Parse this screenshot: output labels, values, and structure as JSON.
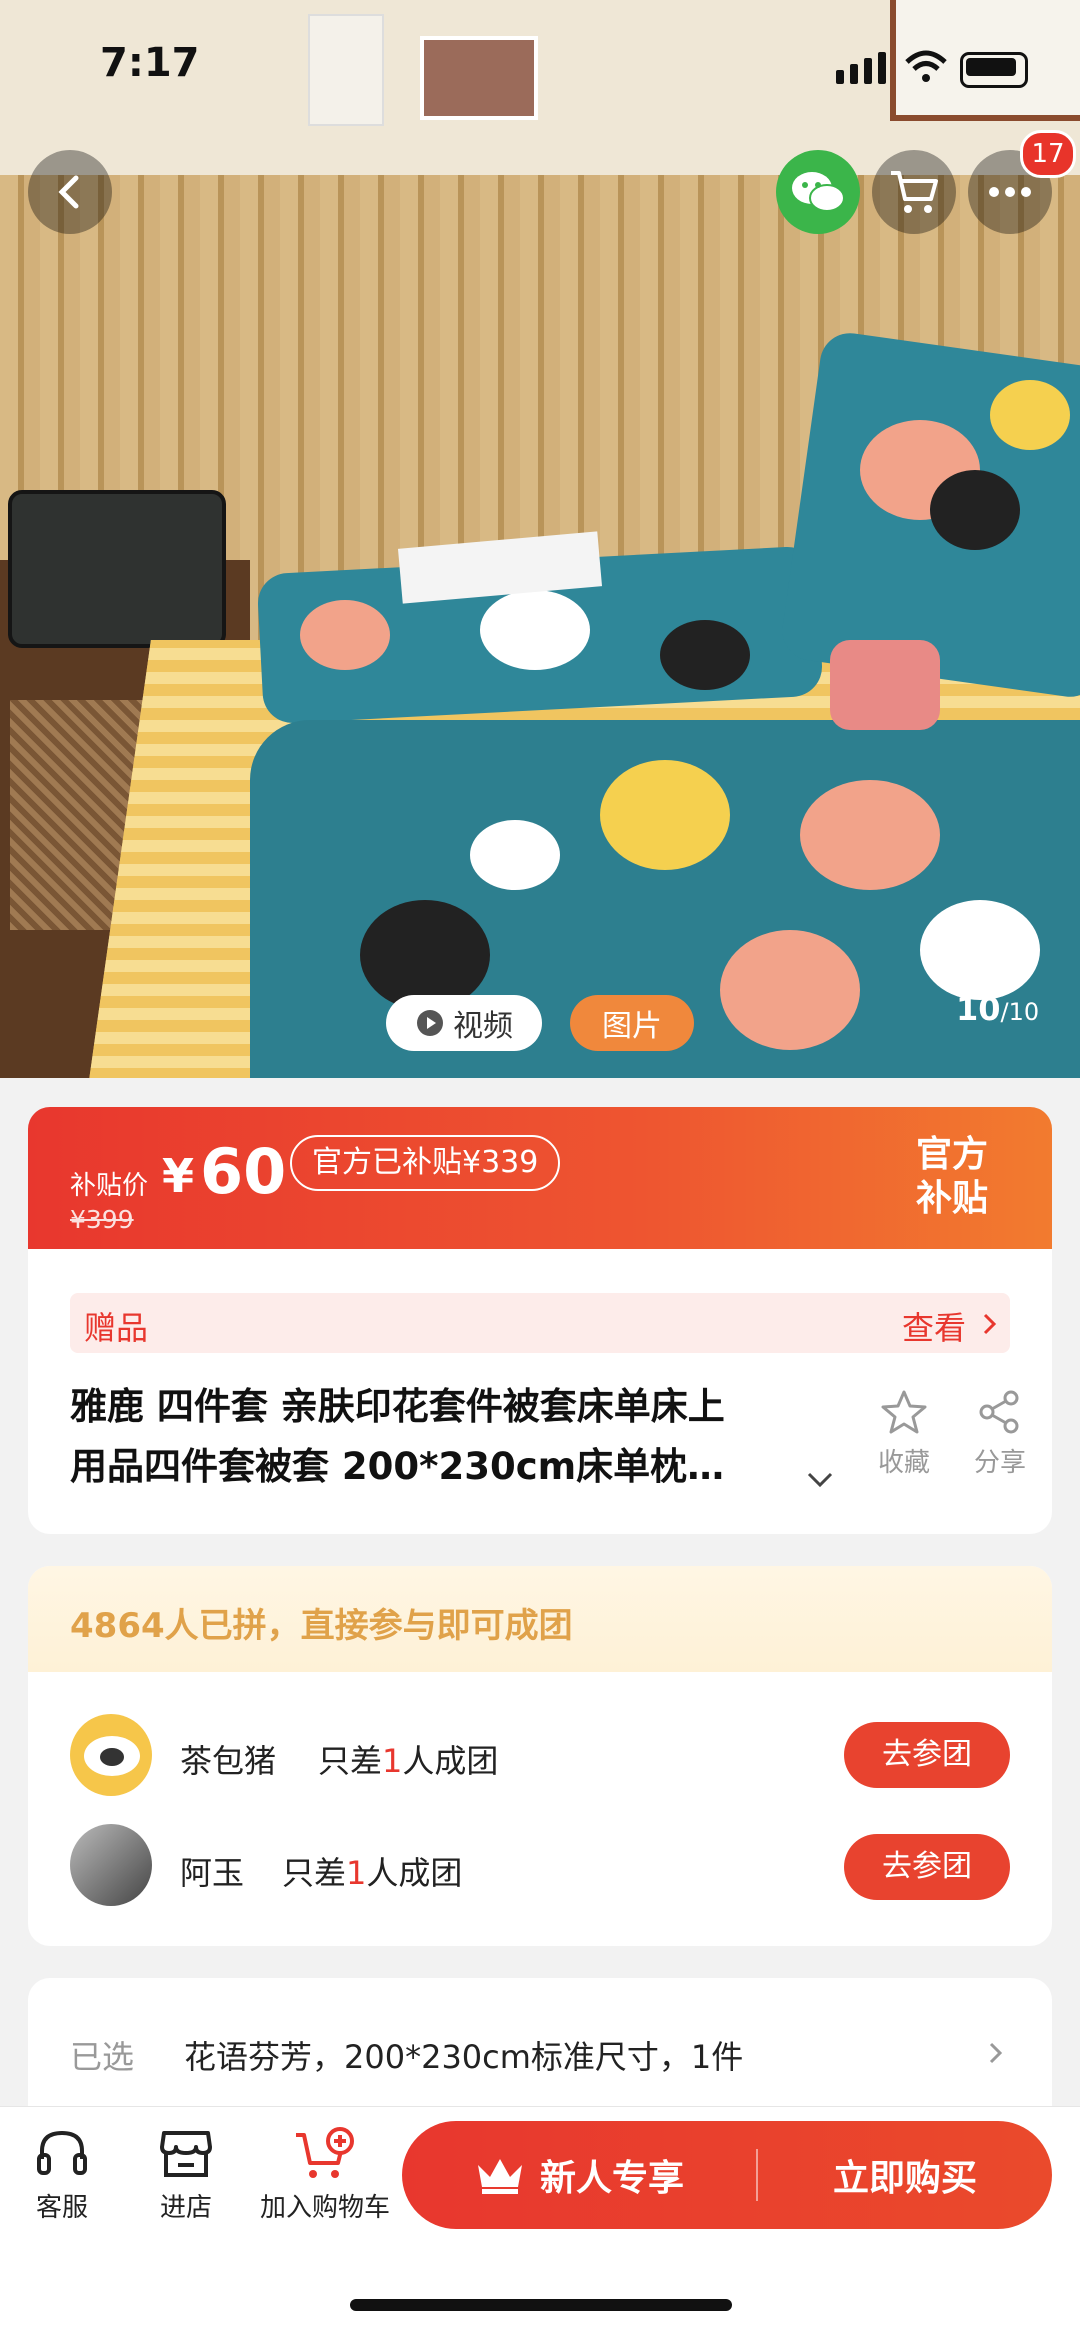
{
  "status_bar": {
    "time": "7:17"
  },
  "nav": {
    "cart_badge": "17"
  },
  "media": {
    "video_label": "视频",
    "image_label": "图片",
    "counter_current": "10",
    "counter_total": "/10"
  },
  "price": {
    "label": "补贴价",
    "currency": "¥",
    "value": "60",
    "original": "¥399",
    "subsidy_tag": "官方已补贴¥339",
    "official_line1": "官方",
    "official_line2": "补贴"
  },
  "gift": {
    "label": "赠品",
    "view": "查看"
  },
  "product": {
    "title_line1": "雅鹿 四件套 亲肤印花套件被套床单床上",
    "title_line2": "用品四件套被套 200*230cm床单枕…",
    "favorite": "收藏",
    "share": "分享"
  },
  "group": {
    "header": "4864人已拼，直接参与即可成团",
    "members": [
      {
        "name": "茶包猪",
        "need_prefix": "只差",
        "need_count": "1",
        "need_suffix": "人成团",
        "button": "去参团"
      },
      {
        "name": "阿玉",
        "need_prefix": "只差",
        "need_count": "1",
        "need_suffix": "人成团",
        "button": "去参团"
      }
    ]
  },
  "selected": {
    "label": "已选",
    "value": "花语芬芳，200*230cm标准尺寸，1件"
  },
  "bottom": {
    "service": "客服",
    "store": "进店",
    "add_cart": "加入购物车",
    "new_user": "新人专享",
    "buy_now": "立即购买"
  },
  "colors": {
    "accent": "#e8372e",
    "orange": "#f27b2f",
    "wechat": "#3bb54a"
  }
}
